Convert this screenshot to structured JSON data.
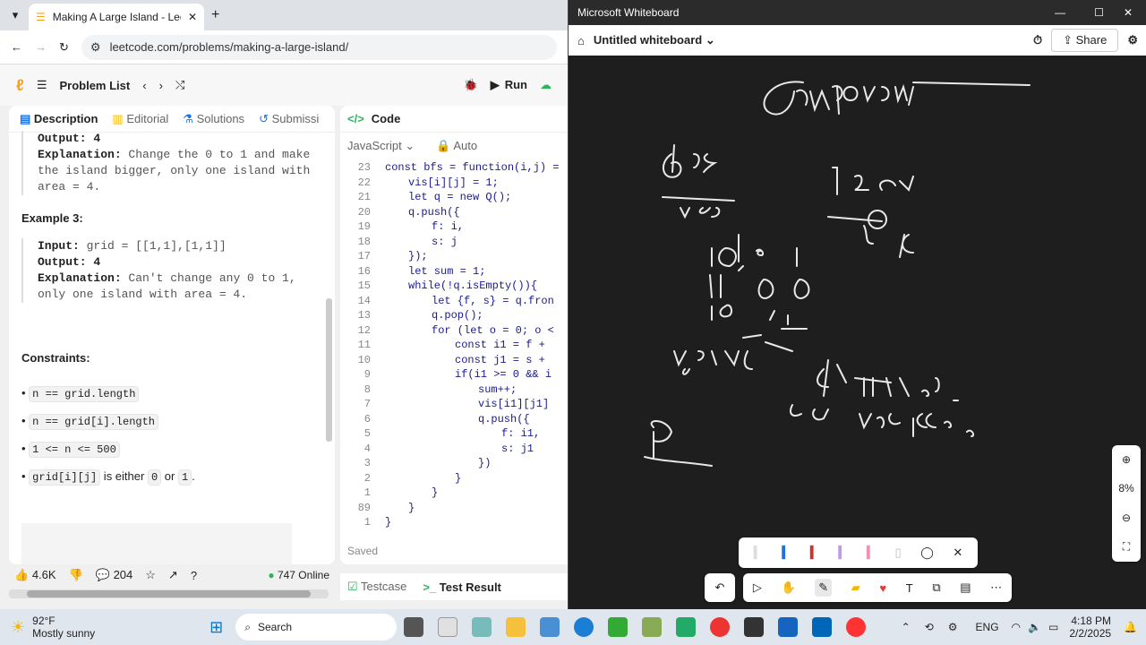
{
  "browser": {
    "tab_title": "Making A Large Island - LeetCo",
    "url": "leetcode.com/problems/making-a-large-island/"
  },
  "leetcode": {
    "problem_list": "Problem List",
    "run": "Run",
    "tabs": [
      "Description",
      "Editorial",
      "Solutions",
      "Submissi"
    ],
    "desc": {
      "out_label": "Output: 4",
      "expl1_label": "Explanation:",
      "expl1_text_a": " Change the 0 to 1 and make",
      "expl1_text_b": "the island bigger, only one island with",
      "expl1_text_c": "area = 4.",
      "example3": "Example 3:",
      "input3_label": "Input:",
      "input3_val": " grid = [[1,1],[1,1]]",
      "output3": "Output: 4",
      "expl3_label": "Explanation:",
      "expl3_text_a": " Can't change any 0 to 1,",
      "expl3_text_b": "only one island with area = 4.",
      "constraints": "Constraints:",
      "c1": "n == grid.length",
      "c2": "n == grid[i].length",
      "c3": "1 <= n <= 500",
      "c4a": "grid[i][j]",
      "c4b": " is either ",
      "c4c": "0",
      "c4d": " or ",
      "c4e": "1",
      "c4f": "."
    },
    "footer": {
      "likes": "4.6K",
      "comments": "204",
      "online": "747 Online"
    },
    "code": {
      "header": "Code",
      "lang": "JavaScript",
      "auto": "Auto",
      "lines": [
        {
          "n": "23",
          "t": "const bfs = function(i,j) =",
          "i": 0
        },
        {
          "n": "22",
          "t": "vis[i][j] = 1;",
          "i": 1
        },
        {
          "n": "21",
          "t": "let q = new Q();",
          "i": 1
        },
        {
          "n": "20",
          "t": "q.push({",
          "i": 1
        },
        {
          "n": "19",
          "t": "f: i,",
          "i": 2
        },
        {
          "n": "18",
          "t": "s: j",
          "i": 2
        },
        {
          "n": "17",
          "t": "});",
          "i": 1
        },
        {
          "n": "16",
          "t": "let sum = 1;",
          "i": 1
        },
        {
          "n": "15",
          "t": "while(!q.isEmpty()){",
          "i": 1
        },
        {
          "n": "14",
          "t": "let {f, s} = q.fron",
          "i": 2
        },
        {
          "n": "13",
          "t": "q.pop();",
          "i": 2
        },
        {
          "n": "12",
          "t": "for (let o = 0; o <",
          "i": 2
        },
        {
          "n": "11",
          "t": "const i1 = f +",
          "i": 3
        },
        {
          "n": "10",
          "t": "const j1 = s +",
          "i": 3
        },
        {
          "n": "9",
          "t": "if(i1 >= 0 && i",
          "i": 3
        },
        {
          "n": "8",
          "t": "sum++;",
          "i": 4
        },
        {
          "n": "7",
          "t": "vis[i1][j1]",
          "i": 4
        },
        {
          "n": "6",
          "t": "q.push({",
          "i": 4
        },
        {
          "n": "5",
          "t": "f: i1,",
          "i": 5
        },
        {
          "n": "4",
          "t": "s: j1",
          "i": 5
        },
        {
          "n": "3",
          "t": "})",
          "i": 4
        },
        {
          "n": "2",
          "t": "}",
          "i": 3
        },
        {
          "n": "1",
          "t": "}",
          "i": 2
        },
        {
          "n": "89",
          "t": "}",
          "i": 1
        },
        {
          "n": "1",
          "t": "}",
          "i": 0
        }
      ],
      "saved": "Saved",
      "testcase": "Testcase",
      "test_result": "Test Result"
    }
  },
  "whiteboard": {
    "app_title": "Microsoft Whiteboard",
    "board_title": "Untitled whiteboard",
    "share": "Share",
    "zoom": "8%"
  },
  "taskbar": {
    "temp": "92°F",
    "weather": "Mostly sunny",
    "search": "Search",
    "lang": "ENG",
    "time": "4:18 PM",
    "date": "2/2/2025"
  }
}
